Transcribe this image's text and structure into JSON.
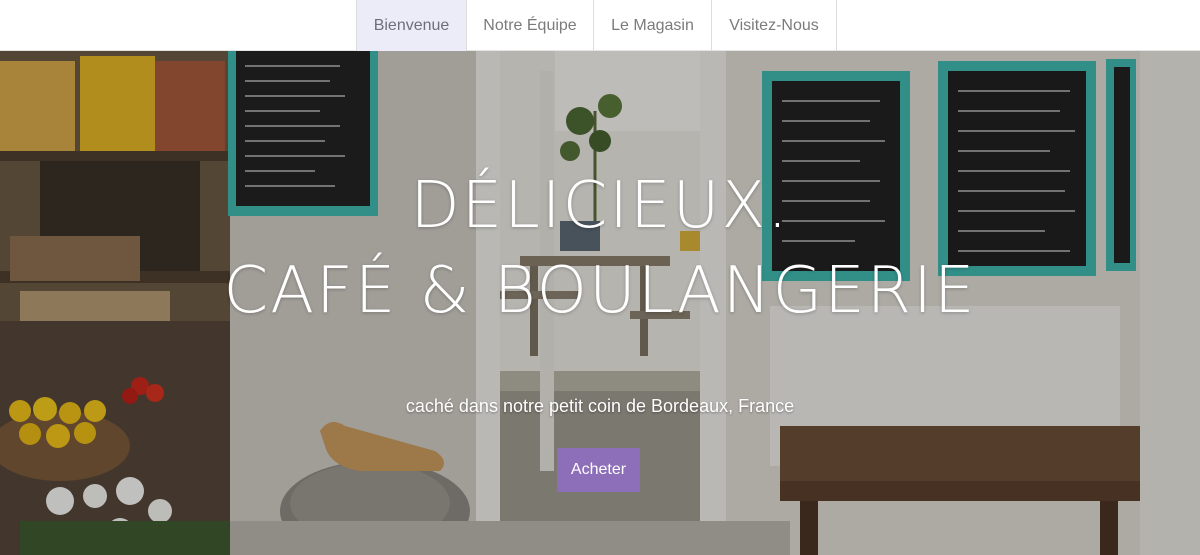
{
  "nav": {
    "items": [
      {
        "label": "Bienvenue",
        "active": true
      },
      {
        "label": "Notre Équipe",
        "active": false
      },
      {
        "label": "Le Magasin",
        "active": false
      },
      {
        "label": "Visitez-Nous",
        "active": false
      }
    ]
  },
  "hero": {
    "title_line1": "DÉLICIEUX.",
    "title_line2": "CAFÉ & BOULANGERIE",
    "subtitle": "caché dans notre petit coin de Bordeaux, France",
    "cta_label": "Acheter",
    "background_image": "cafe-interior-photo"
  },
  "colors": {
    "accent": "#8c6fb8",
    "nav_active_bg": "#ececf8",
    "nav_text": "#7b7b7b",
    "chalkboard_frame": "#3fb8af"
  }
}
